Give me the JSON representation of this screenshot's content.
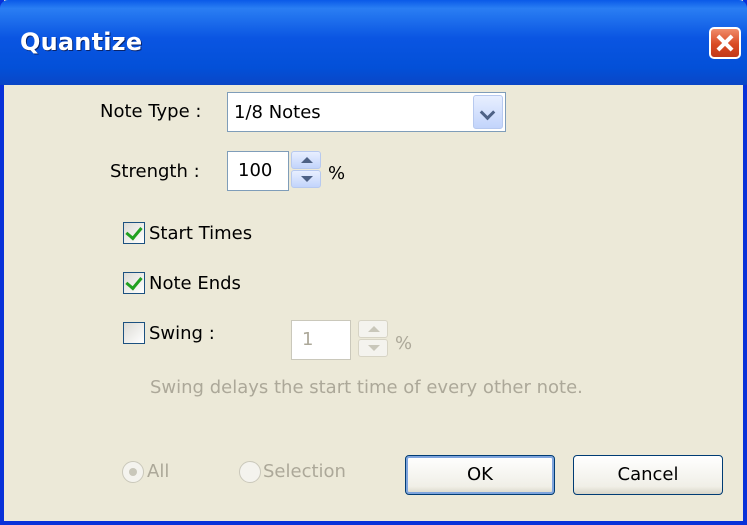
{
  "window": {
    "title": "Quantize"
  },
  "note_type": {
    "label": "Note Type :",
    "value": "1/8 Notes"
  },
  "strength": {
    "label": "Strength :",
    "value": "100",
    "unit": "%"
  },
  "start_times": {
    "label": "Start Times",
    "checked": true
  },
  "note_ends": {
    "label": "Note Ends",
    "checked": true
  },
  "swing": {
    "label": "Swing :",
    "checked": false,
    "value": "1",
    "unit": "%",
    "hint": "Swing delays the start time of every other note."
  },
  "scope": {
    "all_label": "All",
    "selection_label": "Selection",
    "selected": "All"
  },
  "buttons": {
    "ok": "OK",
    "cancel": "Cancel"
  }
}
